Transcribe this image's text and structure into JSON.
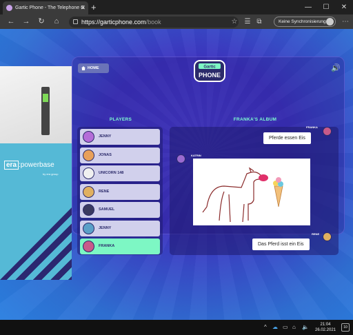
{
  "browser": {
    "tab_title": "Gartic Phone - The Telephone G",
    "tab_close": "✕",
    "new_tab": "+",
    "url_host": "https://garticphone.com",
    "url_path": "/book",
    "sync_label": "Keine Synchronisierung",
    "win_min": "—",
    "win_max": "☐",
    "win_close": "✕"
  },
  "ad": {
    "brand_box": "era",
    "brand_rest": ":powerbase",
    "sub": "by era group"
  },
  "game": {
    "home_label": "HOME",
    "logo_top": "Gartic",
    "logo_bottom": "PHONE",
    "players_title": "PLAYERS",
    "album_title": "FRANKA'S ALBUM",
    "players": [
      {
        "name": "JENNY",
        "color": "#b46cd8"
      },
      {
        "name": "JONAS",
        "color": "#e8a05a"
      },
      {
        "name": "UNICORN 148",
        "color": "#f0f0f0"
      },
      {
        "name": "RENE",
        "color": "#e0b060"
      },
      {
        "name": "SAMUEL",
        "color": "#3a3a60"
      },
      {
        "name": "JENNY",
        "color": "#5aa0c8"
      },
      {
        "name": "FRANKA",
        "color": "#c85a8a"
      }
    ],
    "album": {
      "msg1_author": "FRANKA",
      "msg1_text": "Pferde essen Eis",
      "drawing_author": "KATRIN",
      "msg2_author": "RENE",
      "msg2_text": "Das Pferd isst ein Eis"
    }
  },
  "taskbar": {
    "time": "21:04",
    "date": "26.02.2021",
    "notifications": "10"
  },
  "colors": {
    "accent_green": "#7df7c4",
    "panel_bg": "#2a1f8a"
  }
}
